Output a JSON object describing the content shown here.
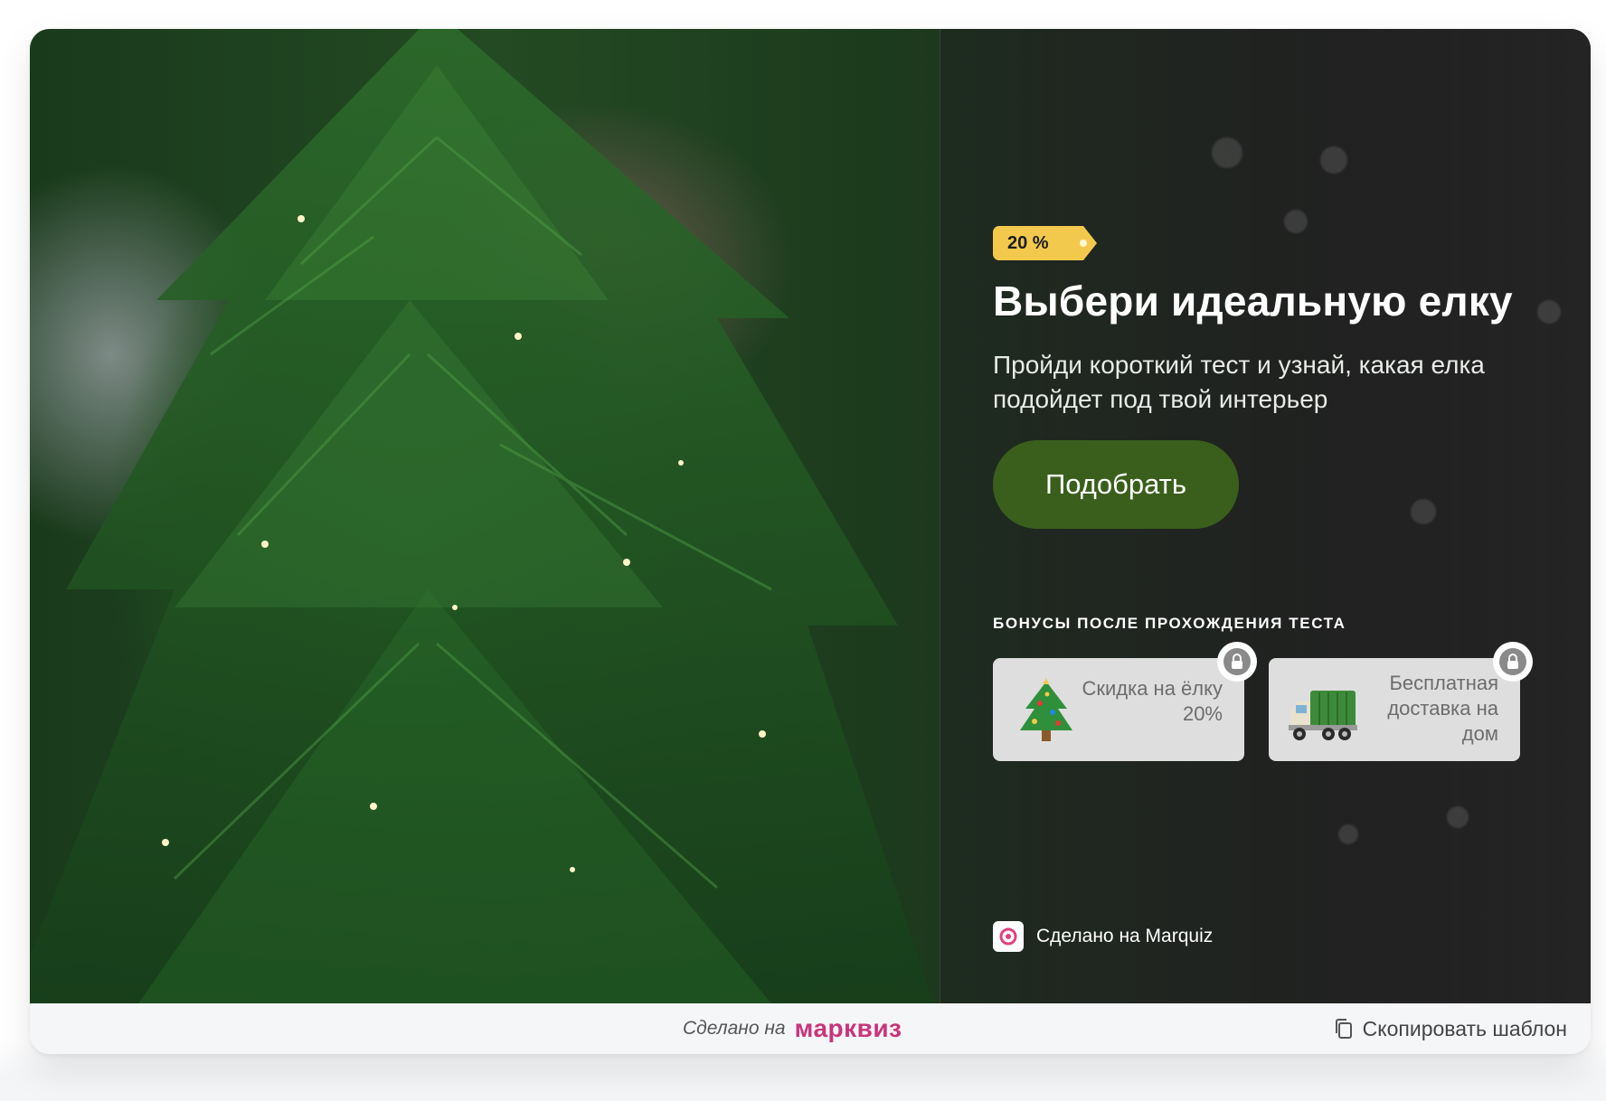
{
  "hero": {
    "badge": "20 %",
    "title": "Выбери идеальную елку",
    "subtitle": "Пройди короткий тест и узнай, какая елка подойдет под твой интерьер",
    "cta_label": "Подобрать",
    "bonuses_heading": "БОНУСЫ ПОСЛЕ ПРОХОЖДЕНИЯ ТЕСТА",
    "bonuses": [
      {
        "icon": "christmas-tree-icon",
        "text": "Скидка на ёлку 20%",
        "locked": true
      },
      {
        "icon": "delivery-truck-icon",
        "text": "Бесплатная доставка на дом",
        "locked": true
      }
    ],
    "made_on": "Сделано на Marquiz"
  },
  "footer": {
    "made_on": "Сделано на",
    "brand": "марквиз",
    "copy_label": "Скопировать шаблон"
  },
  "colors": {
    "badge": "#f2c94c",
    "cta": "#3a5f1c",
    "brand": "#c9347b",
    "bonus_card": "#dedede"
  }
}
